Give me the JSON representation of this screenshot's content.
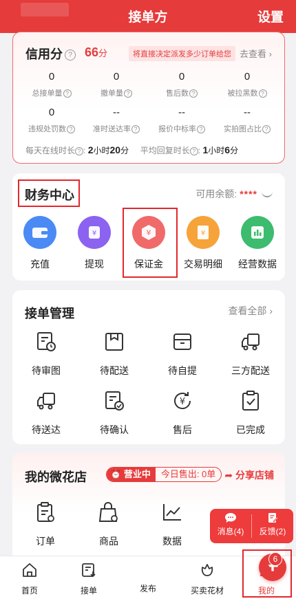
{
  "header": {
    "title": "接单方",
    "settings_label": "设置"
  },
  "credit": {
    "title": "信用分",
    "score_value": "66",
    "score_unit": "分",
    "hint": "将直接决定派发多少订单给您",
    "goto_label": "去查看",
    "stats_row1": [
      {
        "value": "0",
        "label": "总接单量"
      },
      {
        "value": "0",
        "label": "撤单量"
      },
      {
        "value": "0",
        "label": "售后数"
      },
      {
        "value": "0",
        "label": "被拉黑数"
      }
    ],
    "stats_row2": [
      {
        "value": "0",
        "label": "违规处罚数"
      },
      {
        "value": "--",
        "label": "准时送达率"
      },
      {
        "value": "--",
        "label": "报价中标率"
      },
      {
        "value": "--",
        "label": "实拍图占比"
      }
    ],
    "online_label": "每天在线时长",
    "online_hours": "2",
    "online_hours_unit": "小时",
    "online_minutes": "20",
    "online_minutes_unit": "分",
    "reply_label": "平均回复时长",
    "reply_hours": "1",
    "reply_hours_unit": "小时",
    "reply_minutes": "6",
    "reply_minutes_unit": "分"
  },
  "finance": {
    "title": "财务中心",
    "balance_label": "可用余额:",
    "balance_value": "****",
    "items": [
      {
        "label": "充值",
        "icon": "wallet-icon",
        "color": "#4a8af4"
      },
      {
        "label": "提现",
        "icon": "withdraw-icon",
        "color": "#8b63f0"
      },
      {
        "label": "保证金",
        "icon": "deposit-icon",
        "color": "#f06a6a"
      },
      {
        "label": "交易明细",
        "icon": "ledger-icon",
        "color": "#f6a33a"
      },
      {
        "label": "经营数据",
        "icon": "chart-icon",
        "color": "#3dbb6e"
      }
    ]
  },
  "orders": {
    "title": "接单管理",
    "view_all": "查看全部",
    "items": [
      {
        "label": "待审图"
      },
      {
        "label": "待配送"
      },
      {
        "label": "待自提"
      },
      {
        "label": "三方配送"
      },
      {
        "label": "待送达"
      },
      {
        "label": "待确认"
      },
      {
        "label": "售后"
      },
      {
        "label": "已完成"
      }
    ]
  },
  "shop": {
    "title": "我的微花店",
    "status_open": "营业中",
    "sold_today": "今日售出: 0单",
    "share_label": "分享店铺",
    "items": [
      {
        "label": "订单"
      },
      {
        "label": "商品"
      },
      {
        "label": "数据"
      }
    ]
  },
  "float_panel": {
    "messages_label": "消息(4)",
    "feedback_label": "反馈(2)"
  },
  "tabbar": {
    "items": [
      {
        "label": "首页"
      },
      {
        "label": "接单"
      },
      {
        "label": "发布"
      },
      {
        "label": "买卖花材"
      },
      {
        "label": "我的"
      }
    ],
    "mine_badge": "6"
  },
  "colors": {
    "brand_red": "#e63b3b",
    "highlight_red": "#e3262c"
  }
}
